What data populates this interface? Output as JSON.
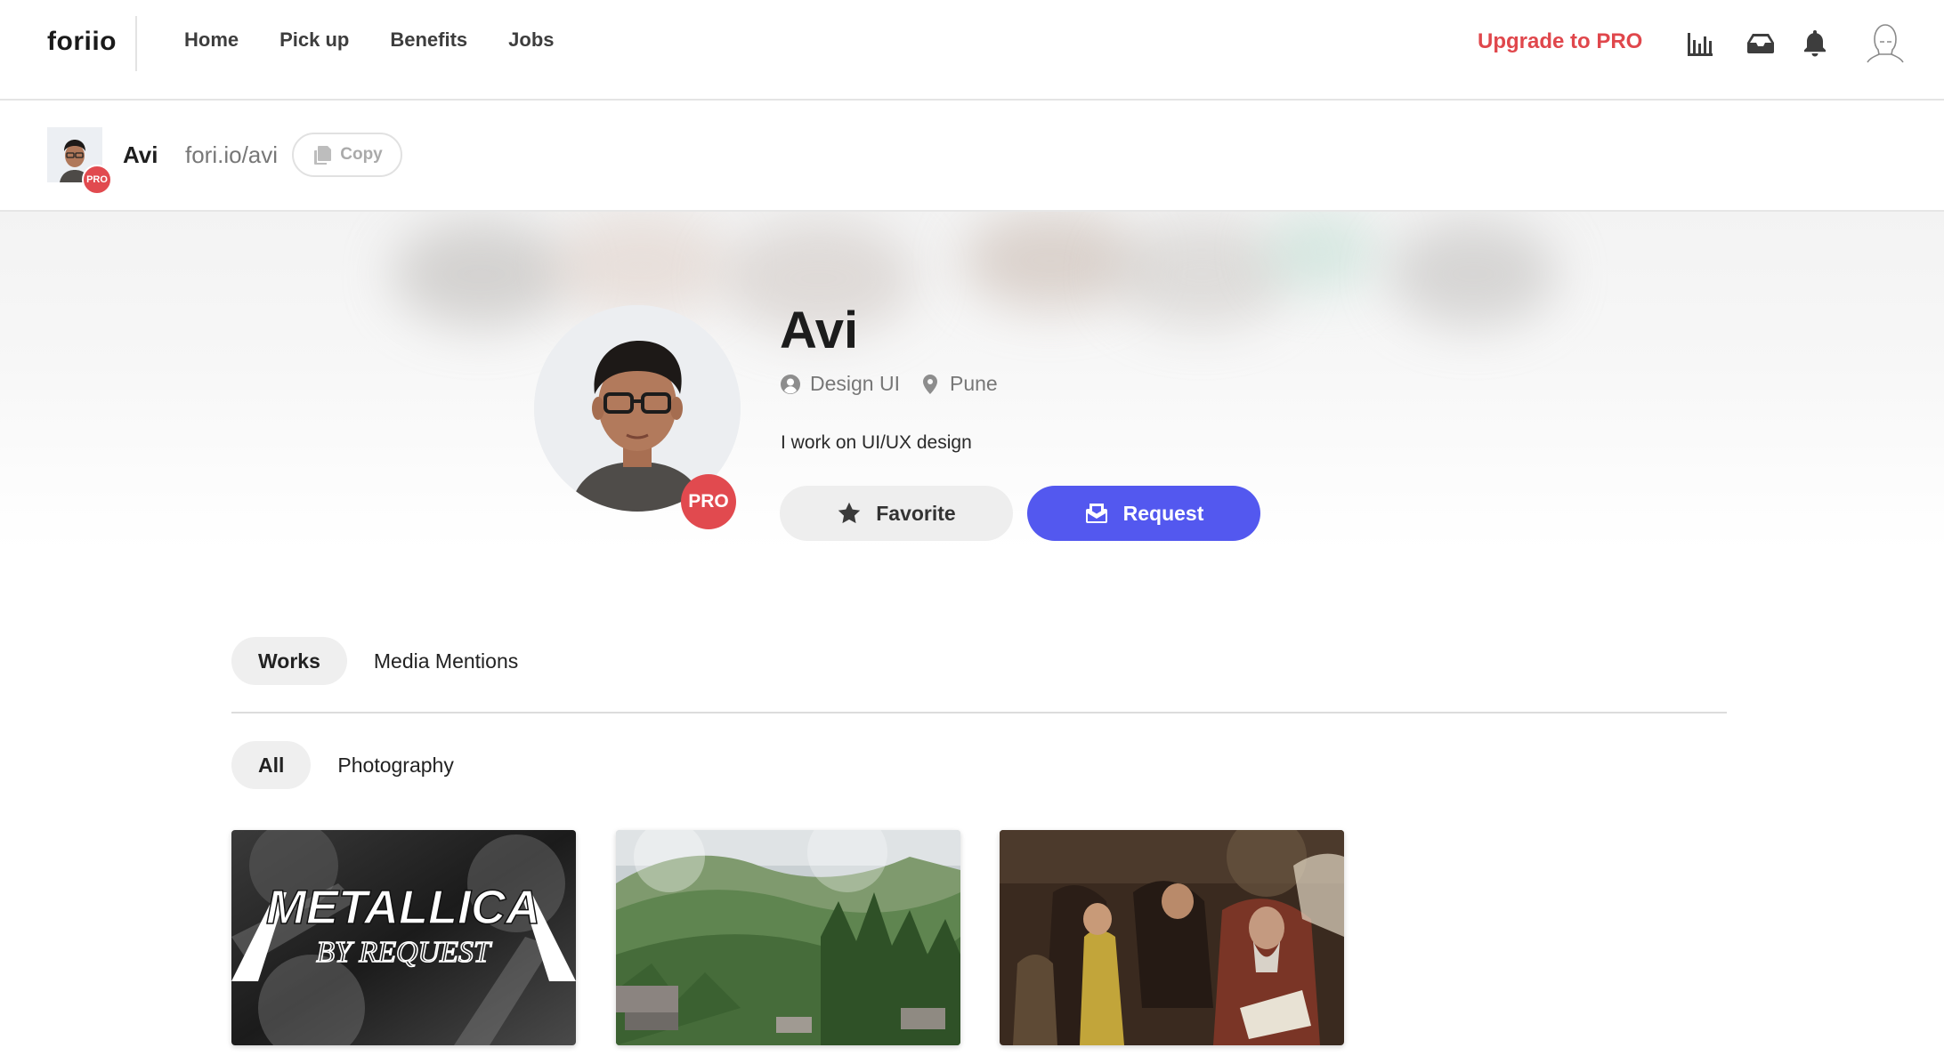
{
  "nav": {
    "logo": "foriio",
    "links": [
      "Home",
      "Pick up",
      "Benefits",
      "Jobs"
    ],
    "upgrade_label": "Upgrade to PRO",
    "icons": [
      "analytics-icon",
      "inbox-icon",
      "bell-icon",
      "user-avatar-icon"
    ],
    "accent_color": "#e0474c"
  },
  "subbar": {
    "name": "Avi",
    "url": "fori.io/avi",
    "copy_label": "Copy",
    "badge": "PRO"
  },
  "profile": {
    "name": "Avi",
    "badge": "PRO",
    "role": "Design UI",
    "location": "Pune",
    "bio": "I work on UI/UX design",
    "favorite_label": "Favorite",
    "request_label": "Request",
    "request_color": "#5358ef"
  },
  "tabs": {
    "items": [
      "Works",
      "Media Mentions"
    ],
    "active": "Works"
  },
  "filters": {
    "items": [
      "All",
      "Photography"
    ],
    "active": "All"
  },
  "works": [
    {
      "title_line1": "METALLICA",
      "title_line2": "BY REQUEST"
    },
    {
      "subject": "mountain-landscape"
    },
    {
      "subject": "classical-painting"
    }
  ]
}
